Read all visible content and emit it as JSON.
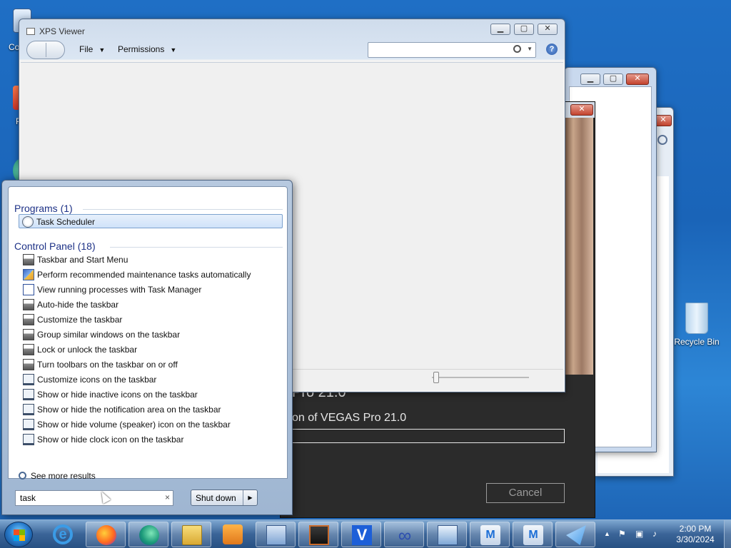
{
  "desktop": {
    "partial_icon_label": "Co",
    "partial_icon2_label": "P",
    "recycle_bin_label": "Recycle Bin"
  },
  "xps_viewer": {
    "title": "XPS Viewer",
    "menu_file": "File",
    "menu_permissions": "Permissions",
    "search_placeholder": "",
    "help_glyph": "?"
  },
  "vegas_installer": {
    "heading": "Pro 21.0",
    "status_text": "on of VEGAS Pro 21.0",
    "cancel_label": "Cancel"
  },
  "start_menu": {
    "programs_header": "Programs (1)",
    "programs": [
      {
        "label": "Task Scheduler",
        "icon": "clock-icon"
      }
    ],
    "control_panel_header": "Control Panel (18)",
    "control_panel_items": [
      {
        "label": "Taskbar and Start Menu",
        "icon": "taskbar-icon"
      },
      {
        "label": "Perform recommended maintenance tasks automatically",
        "icon": "action-center-icon"
      },
      {
        "label": "View running processes with Task Manager",
        "icon": "task-manager-icon"
      },
      {
        "label": "Auto-hide the taskbar",
        "icon": "taskbar-icon"
      },
      {
        "label": "Customize the taskbar",
        "icon": "taskbar-icon"
      },
      {
        "label": "Group similar windows on the taskbar",
        "icon": "taskbar-icon"
      },
      {
        "label": "Lock or unlock the taskbar",
        "icon": "taskbar-icon"
      },
      {
        "label": "Turn toolbars on the taskbar on or off",
        "icon": "taskbar-icon"
      },
      {
        "label": "Customize icons on the taskbar",
        "icon": "monitor-icon"
      },
      {
        "label": "Show or hide inactive icons on the taskbar",
        "icon": "monitor-icon"
      },
      {
        "label": "Show or hide the notification area on the taskbar",
        "icon": "monitor-icon"
      },
      {
        "label": "Show or hide volume (speaker) icon on the taskbar",
        "icon": "monitor-icon"
      },
      {
        "label": "Show or hide clock icon on the taskbar",
        "icon": "monitor-icon"
      }
    ],
    "see_more": "See more results",
    "search_value": "task",
    "clear_glyph": "×",
    "shutdown_label": "Shut down"
  },
  "taskbar": {
    "time": "2:00 PM",
    "date": "3/30/2024",
    "pinned": [
      "internet-explorer-icon",
      "firefox-icon",
      "edge-icon",
      "file-explorer-icon",
      "media-player-icon",
      "network-tool-icon",
      "monitor-app-icon",
      "vegas-v-icon",
      "infinity-icon",
      "display-settings-icon",
      "installer-m-icon",
      "installer-m2-icon",
      "paper-plane-icon"
    ],
    "colors": {
      "accent": "#1f6fc5",
      "vegas": "#1d5fd8"
    }
  }
}
